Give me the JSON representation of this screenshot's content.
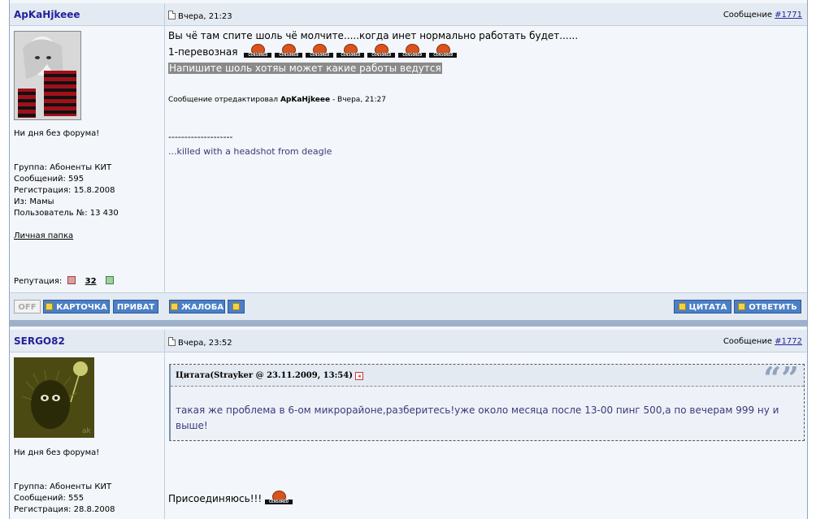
{
  "posts": [
    {
      "author": "ApKaHjkeee",
      "date": "Вчера, 21:23",
      "msg_label": "Сообщение",
      "msg_number": "#1771",
      "status": "Ни дня без форума!",
      "group": "Группа: Абоненты КИТ",
      "messages": "Сообщений: 595",
      "registered": "Регистрация: 15.8.2008",
      "from": "Из: Мамы",
      "user_no": "Пользователь №: 13 430",
      "personal_folder": "Личная папка",
      "rep_label": "Репутация:",
      "rep_value": "32",
      "line1": "Вы чё там спите шоль чё молчите.....когда инет нормально работать будет......",
      "line2": "1-перевозная",
      "line3": "Напишите шоль хотяы может какие работы ведутся",
      "edited_prefix": "Сообщение отредактировал",
      "edited_by": "ApKaHjkeee",
      "edited_time": "- Вчера, 21:27",
      "sig_dashes": "--------------------",
      "signature": "...killed with a headshot from deagle",
      "smiley_text": "CENSORED"
    },
    {
      "author": "SERGO82",
      "date": "Вчера, 23:52",
      "msg_label": "Сообщение",
      "msg_number": "#1772",
      "status": "Ни дня без форума!",
      "group": "Группа: Абоненты КИТ",
      "messages": "Сообщений: 555",
      "registered": "Регистрация: 28.8.2008",
      "quote_title": "Цитата(Strayker @ 23.11.2009, 13:54)",
      "quote_text": "такая же проблема в 6-ом микрорайоне,разберитесь!уже около месяца после 13-00 пинг 500,а по вечерам 999 ну и выше!",
      "body": "Присоединяюсь!!!"
    }
  ],
  "buttons": {
    "off": "OFF",
    "card": "КАРТОЧКА",
    "private": "ПРИВАТ",
    "complaint": "ЖАЛОБА",
    "quote": "ЦИТАТА",
    "reply": "ОТВЕТИТЬ"
  },
  "icons": {
    "quote_marks": "“”"
  },
  "colors": {
    "author": "#22229c",
    "button": "#4b7fc6",
    "header_bg": "#e4eaf2",
    "separator": "#9fb1c9"
  }
}
